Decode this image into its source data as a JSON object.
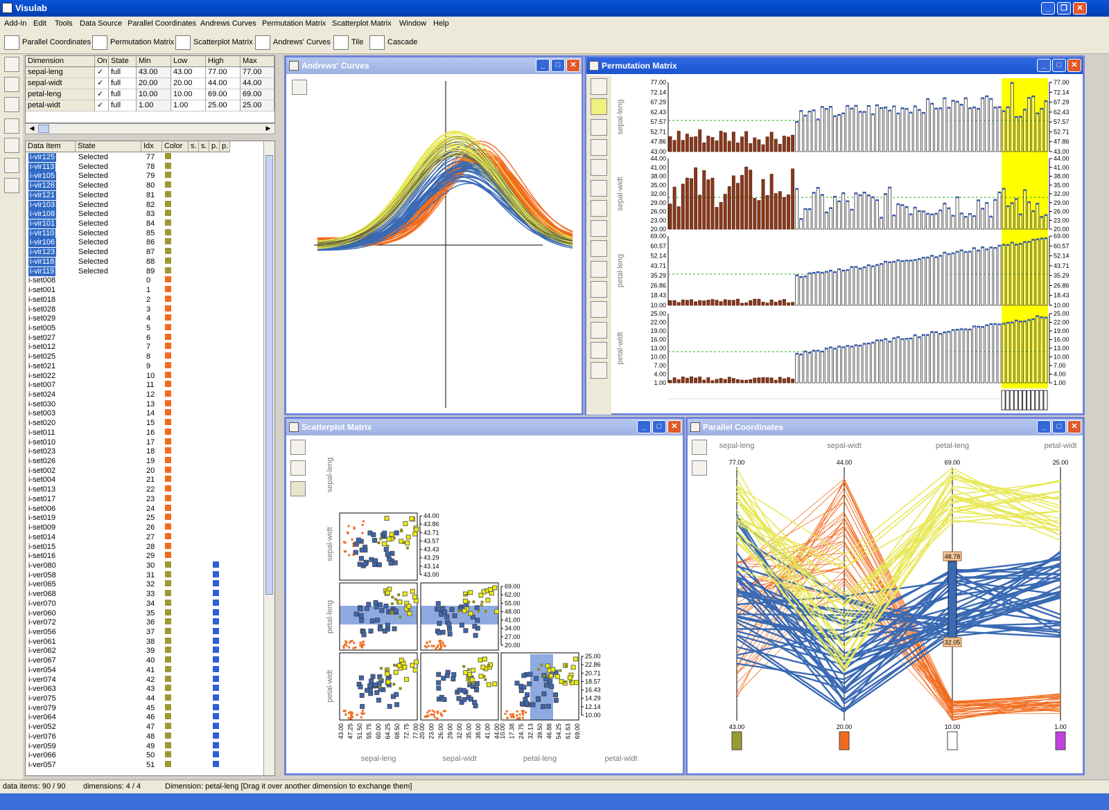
{
  "app": {
    "title": "Visulab"
  },
  "menu": [
    "Add-In",
    "Edit",
    "Tools",
    "Data Source",
    "Parallel Coordinates",
    "Andrews Curves",
    "Permutation Matrix",
    "Scatterplot Matrix",
    "Window",
    "Help"
  ],
  "toolbar": {
    "parallel": "Parallel Coordinates",
    "permutation": "Permutation Matrix",
    "scatterplot": "Scatterplot Matrix",
    "andrews": "Andrews' Curves",
    "tile": "Tile",
    "cascade": "Cascade"
  },
  "dimension_table": {
    "headers": [
      "Dimension",
      "On",
      "State",
      "Min",
      "Low",
      "High",
      "Max"
    ],
    "rows": [
      {
        "name": "sepal-leng",
        "on": "✓",
        "state": "full",
        "min": "43.00",
        "low": "43.00",
        "high": "77.00",
        "max": "77.00"
      },
      {
        "name": "sepal-widt",
        "on": "✓",
        "state": "full",
        "min": "20.00",
        "low": "20.00",
        "high": "44.00",
        "max": "44.00"
      },
      {
        "name": "petal-leng",
        "on": "✓",
        "state": "full",
        "min": "10.00",
        "low": "10.00",
        "high": "69.00",
        "max": "69.00"
      },
      {
        "name": "petal-widt",
        "on": "✓",
        "state": "full",
        "min": "1.00",
        "low": "1.00",
        "high": "25.00",
        "max": "25.00"
      }
    ]
  },
  "data_table": {
    "headers": [
      "Data Item",
      "State",
      "Idx",
      "Color",
      "s.",
      "s.",
      "p.",
      "p."
    ],
    "rows": [
      {
        "item": "i-vir125",
        "state": "Selected",
        "idx": "77",
        "color": "#9a9a32",
        "sel": true
      },
      {
        "item": "i-vir113",
        "state": "Selected",
        "idx": "78",
        "color": "#9a9a32",
        "sel": true
      },
      {
        "item": "i-vir105",
        "state": "Selected",
        "idx": "79",
        "color": "#9a9a32",
        "sel": true
      },
      {
        "item": "i-vir126",
        "state": "Selected",
        "idx": "80",
        "color": "#9a9a32",
        "sel": true
      },
      {
        "item": "i-vir121",
        "state": "Selected",
        "idx": "81",
        "color": "#9a9a32",
        "sel": true
      },
      {
        "item": "i-vir103",
        "state": "Selected",
        "idx": "82",
        "color": "#9a9a32",
        "sel": true
      },
      {
        "item": "i-vir108",
        "state": "Selected",
        "idx": "83",
        "color": "#9a9a32",
        "sel": true
      },
      {
        "item": "i-vir101",
        "state": "Selected",
        "idx": "84",
        "color": "#9a9a32",
        "sel": true
      },
      {
        "item": "i-vir110",
        "state": "Selected",
        "idx": "85",
        "color": "#9a9a32",
        "sel": true
      },
      {
        "item": "i-vir106",
        "state": "Selected",
        "idx": "86",
        "color": "#9a9a32",
        "sel": true
      },
      {
        "item": "i-vir123",
        "state": "Selected",
        "idx": "87",
        "color": "#9a9a32",
        "sel": true
      },
      {
        "item": "i-vir118",
        "state": "Selected",
        "idx": "88",
        "color": "#9a9a32",
        "sel": true
      },
      {
        "item": "i-vir119",
        "state": "Selected",
        "idx": "89",
        "color": "#9a9a32",
        "sel": true
      },
      {
        "item": "i-set008",
        "state": "",
        "idx": "0",
        "color": "#f26b1d"
      },
      {
        "item": "i-set001",
        "state": "",
        "idx": "1",
        "color": "#f26b1d"
      },
      {
        "item": "i-set018",
        "state": "",
        "idx": "2",
        "color": "#f26b1d"
      },
      {
        "item": "i-set028",
        "state": "",
        "idx": "3",
        "color": "#f26b1d"
      },
      {
        "item": "i-set029",
        "state": "",
        "idx": "4",
        "color": "#f26b1d"
      },
      {
        "item": "i-set005",
        "state": "",
        "idx": "5",
        "color": "#f26b1d"
      },
      {
        "item": "i-set027",
        "state": "",
        "idx": "6",
        "color": "#f26b1d"
      },
      {
        "item": "i-set012",
        "state": "",
        "idx": "7",
        "color": "#f26b1d"
      },
      {
        "item": "i-set025",
        "state": "",
        "idx": "8",
        "color": "#f26b1d"
      },
      {
        "item": "i-set021",
        "state": "",
        "idx": "9",
        "color": "#f26b1d"
      },
      {
        "item": "i-set022",
        "state": "",
        "idx": "10",
        "color": "#f26b1d"
      },
      {
        "item": "i-set007",
        "state": "",
        "idx": "11",
        "color": "#f26b1d"
      },
      {
        "item": "i-set024",
        "state": "",
        "idx": "12",
        "color": "#f26b1d"
      },
      {
        "item": "i-set030",
        "state": "",
        "idx": "13",
        "color": "#f26b1d"
      },
      {
        "item": "i-set003",
        "state": "",
        "idx": "14",
        "color": "#f26b1d"
      },
      {
        "item": "i-set020",
        "state": "",
        "idx": "15",
        "color": "#f26b1d"
      },
      {
        "item": "i-set011",
        "state": "",
        "idx": "16",
        "color": "#f26b1d"
      },
      {
        "item": "i-set010",
        "state": "",
        "idx": "17",
        "color": "#f26b1d"
      },
      {
        "item": "i-set023",
        "state": "",
        "idx": "18",
        "color": "#f26b1d"
      },
      {
        "item": "i-set026",
        "state": "",
        "idx": "19",
        "color": "#f26b1d"
      },
      {
        "item": "i-set002",
        "state": "",
        "idx": "20",
        "color": "#f26b1d"
      },
      {
        "item": "i-set004",
        "state": "",
        "idx": "21",
        "color": "#f26b1d"
      },
      {
        "item": "i-set013",
        "state": "",
        "idx": "22",
        "color": "#f26b1d"
      },
      {
        "item": "i-set017",
        "state": "",
        "idx": "23",
        "color": "#f26b1d"
      },
      {
        "item": "i-set006",
        "state": "",
        "idx": "24",
        "color": "#f26b1d"
      },
      {
        "item": "i-set019",
        "state": "",
        "idx": "25",
        "color": "#f26b1d"
      },
      {
        "item": "i-set009",
        "state": "",
        "idx": "26",
        "color": "#f26b1d"
      },
      {
        "item": "i-set014",
        "state": "",
        "idx": "27",
        "color": "#f26b1d"
      },
      {
        "item": "i-set015",
        "state": "",
        "idx": "28",
        "color": "#f26b1d"
      },
      {
        "item": "i-set016",
        "state": "",
        "idx": "29",
        "color": "#f26b1d"
      },
      {
        "item": "i-ver080",
        "state": "",
        "idx": "30",
        "color": "#9a9a32",
        "p": true
      },
      {
        "item": "i-ver058",
        "state": "",
        "idx": "31",
        "color": "#9a9a32",
        "p": true
      },
      {
        "item": "i-ver065",
        "state": "",
        "idx": "32",
        "color": "#9a9a32",
        "p": true
      },
      {
        "item": "i-ver068",
        "state": "",
        "idx": "33",
        "color": "#9a9a32",
        "p": true
      },
      {
        "item": "i-ver070",
        "state": "",
        "idx": "34",
        "color": "#9a9a32",
        "p": true
      },
      {
        "item": "i-ver060",
        "state": "",
        "idx": "35",
        "color": "#9a9a32",
        "p": true
      },
      {
        "item": "i-ver072",
        "state": "",
        "idx": "36",
        "color": "#9a9a32",
        "p": true
      },
      {
        "item": "i-ver056",
        "state": "",
        "idx": "37",
        "color": "#9a9a32",
        "p": true
      },
      {
        "item": "i-ver061",
        "state": "",
        "idx": "38",
        "color": "#9a9a32",
        "p": true
      },
      {
        "item": "i-ver062",
        "state": "",
        "idx": "39",
        "color": "#9a9a32",
        "p": true
      },
      {
        "item": "i-ver067",
        "state": "",
        "idx": "40",
        "color": "#9a9a32",
        "p": true
      },
      {
        "item": "i-ver054",
        "state": "",
        "idx": "41",
        "color": "#9a9a32",
        "p": true
      },
      {
        "item": "i-ver074",
        "state": "",
        "idx": "42",
        "color": "#9a9a32",
        "p": true
      },
      {
        "item": "i-ver063",
        "state": "",
        "idx": "43",
        "color": "#9a9a32",
        "p": true
      },
      {
        "item": "i-ver075",
        "state": "",
        "idx": "44",
        "color": "#9a9a32",
        "p": true
      },
      {
        "item": "i-ver079",
        "state": "",
        "idx": "45",
        "color": "#9a9a32",
        "p": true
      },
      {
        "item": "i-ver064",
        "state": "",
        "idx": "46",
        "color": "#9a9a32",
        "p": true
      },
      {
        "item": "i-ver052",
        "state": "",
        "idx": "47",
        "color": "#9a9a32",
        "p": true
      },
      {
        "item": "i-ver076",
        "state": "",
        "idx": "48",
        "color": "#9a9a32",
        "p": true
      },
      {
        "item": "i-ver059",
        "state": "",
        "idx": "49",
        "color": "#9a9a32",
        "p": true
      },
      {
        "item": "i-ver066",
        "state": "",
        "idx": "50",
        "color": "#9a9a32",
        "p": true
      },
      {
        "item": "i-ver057",
        "state": "",
        "idx": "51",
        "color": "#9a9a32",
        "p": true
      }
    ]
  },
  "windows": {
    "andrews": "Andrews' Curves",
    "permutation": "Permutation Matrix",
    "scatter": "Scatterplot Matrix",
    "parallel": "Parallel Coordinates"
  },
  "permutation": {
    "dims": [
      {
        "name": "sepal-leng",
        "ticks": [
          "77.00",
          "72.14",
          "67.29",
          "62.43",
          "57.57",
          "52.71",
          "47.86",
          "43.00"
        ]
      },
      {
        "name": "sepal-widt",
        "ticks": [
          "44.00",
          "41.00",
          "38.00",
          "35.00",
          "32.00",
          "29.00",
          "26.00",
          "23.00",
          "20.00"
        ]
      },
      {
        "name": "petal-leng",
        "ticks": [
          "69.00",
          "60.57",
          "52.14",
          "43.71",
          "35.29",
          "26.86",
          "18.43",
          "10.00"
        ]
      },
      {
        "name": "petal-widt",
        "ticks": [
          "25.00",
          "22.00",
          "19.00",
          "16.00",
          "13.00",
          "10.00",
          "7.00",
          "4.00",
          "1.00"
        ]
      }
    ]
  },
  "scatter": {
    "dims": [
      "sepal-leng",
      "sepal-widt",
      "petal-leng",
      "petal-widt"
    ],
    "sw_ticks": [
      "44.00",
      "43.86",
      "43.71",
      "43.57",
      "43.43",
      "43.29",
      "43.14",
      "43.00"
    ],
    "pl_ticks": [
      "69.00",
      "62.00",
      "55.00",
      "48.00",
      "41.00",
      "34.00",
      "27.00",
      "20.00"
    ],
    "pw_ticks": [
      "25.00",
      "22.86",
      "20.71",
      "18.57",
      "16.43",
      "14.29",
      "12.14",
      "10.00"
    ],
    "x1_ticks": [
      "43.00",
      "47.25",
      "51.50",
      "55.75",
      "60.00",
      "64.25",
      "68.50",
      "72.75",
      "77.00"
    ],
    "x2_ticks": [
      "20.00",
      "23.00",
      "26.00",
      "29.00",
      "32.00",
      "35.00",
      "38.00",
      "41.00",
      "44.00"
    ],
    "x3_ticks": [
      "10.00",
      "17.38",
      "24.75",
      "32.13",
      "39.50",
      "46.88",
      "54.25",
      "61.63",
      "69.00"
    ]
  },
  "parallel": {
    "axes": [
      {
        "name": "sepal-leng",
        "max": "77.00",
        "min": "43.00",
        "color": "#9a9a32"
      },
      {
        "name": "sepal-widt",
        "max": "44.00",
        "min": "20.00",
        "color": "#f26b1d"
      },
      {
        "name": "petal-leng",
        "max": "69.00",
        "min": "10.00",
        "color": "#ffffff"
      },
      {
        "name": "petal-widt",
        "max": "25.00",
        "min": "1.00",
        "color": "#c040e0"
      }
    ],
    "brush_high": "48.78",
    "brush_low": "32.05"
  },
  "status": {
    "items": "data items: 90 / 90",
    "dims": "dimensions: 4 / 4",
    "msg": "Dimension: petal-leng [Drag it over another dimension to exchange them]"
  },
  "colors": {
    "selected": "#f0f000",
    "versicolor": "#3a6ab4",
    "setosa": "#f26b1d",
    "accent": "#0a55d8"
  }
}
